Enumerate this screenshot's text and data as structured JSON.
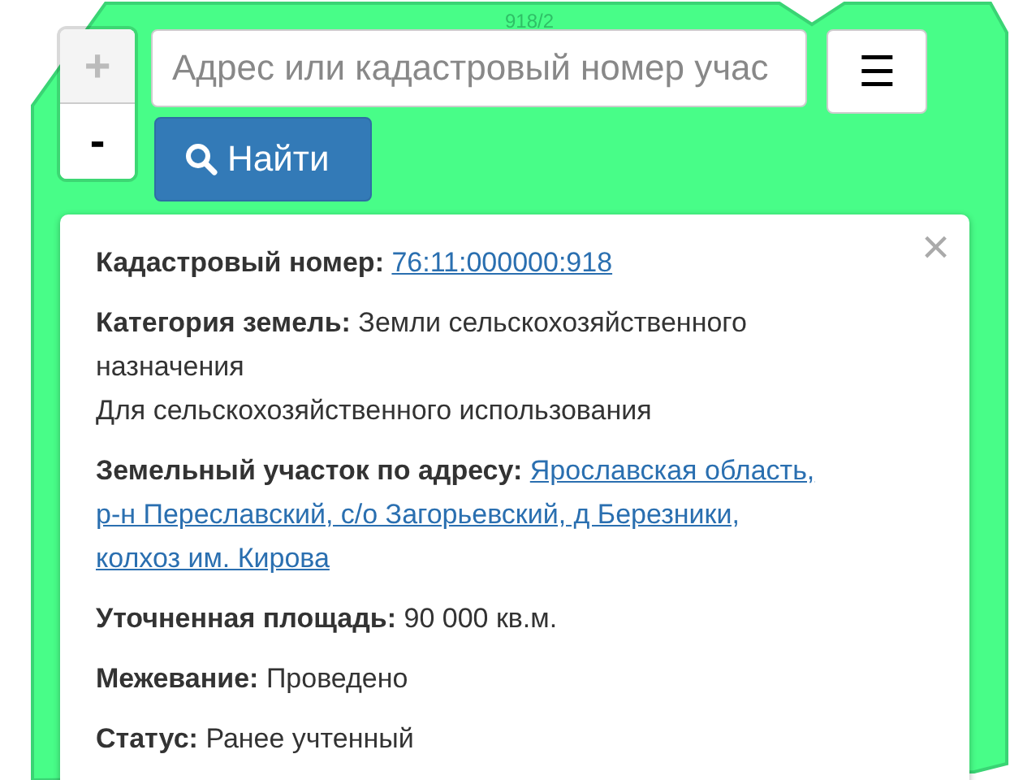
{
  "map": {
    "parcel_label": "918/2"
  },
  "zoom": {
    "in": "+",
    "out": "-",
    "in_disabled": true
  },
  "search": {
    "placeholder": "Адрес или кадастровый номер учас"
  },
  "menu_button": "☰",
  "find_button": "Найти",
  "popup": {
    "close": "×",
    "fields": [
      {
        "label": "Кадастровый номер:",
        "kind": "link",
        "lines": [
          "76:11:000000:918"
        ]
      },
      {
        "label": "Категория земель:",
        "kind": "text",
        "lines": [
          "Земли сельскохозяйственного",
          "назначения",
          "Для сельскохозяйственного использования"
        ]
      },
      {
        "label": "Земельный участок по адресу:",
        "kind": "link",
        "lines": [
          "Ярославская область,",
          "р-н Переславский, с/о Загорьевский, д Березники,",
          "колхоз им. Кирова"
        ]
      },
      {
        "label": "Уточненная площадь:",
        "kind": "text",
        "lines": [
          "90 000 кв.м."
        ]
      },
      {
        "label": "Межевание:",
        "kind": "text",
        "lines": [
          "Проведено"
        ]
      },
      {
        "label": "Статус:",
        "kind": "text",
        "lines": [
          "Ранее учтенный"
        ]
      }
    ]
  }
}
